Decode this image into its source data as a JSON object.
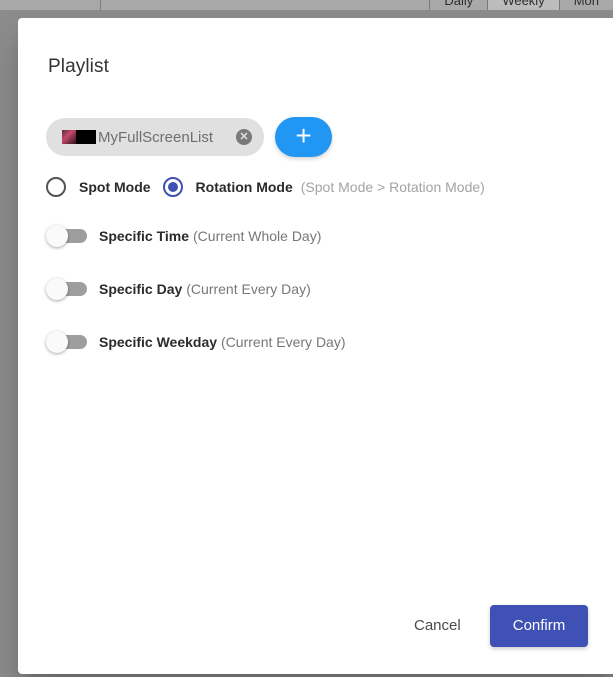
{
  "background": {
    "tabs": [
      {
        "label": "Daily",
        "active": false
      },
      {
        "label": "Weekly",
        "active": true
      },
      {
        "label": "Mon",
        "active": false
      }
    ]
  },
  "dialog": {
    "title": "Playlist",
    "chip": {
      "label": "MyFullScreenList",
      "remove_icon": "cancel-circle-icon"
    },
    "add_button": {
      "label": "+",
      "color": "#2196f3"
    },
    "modes": {
      "options": [
        {
          "label": "Spot Mode",
          "checked": false
        },
        {
          "label": "Rotation Mode",
          "checked": true
        }
      ],
      "hint": "(Spot Mode > Rotation Mode)",
      "accent_color": "#3f51b5"
    },
    "toggles": [
      {
        "label": "Specific Time",
        "hint": "(Current Whole Day)",
        "on": false
      },
      {
        "label": "Specific Day",
        "hint": "(Current Every Day)",
        "on": false
      },
      {
        "label": "Specific Weekday",
        "hint": "(Current Every Day)",
        "on": false
      }
    ],
    "footer": {
      "cancel_label": "Cancel",
      "confirm_label": "Confirm",
      "confirm_color": "#3f51b5"
    }
  }
}
